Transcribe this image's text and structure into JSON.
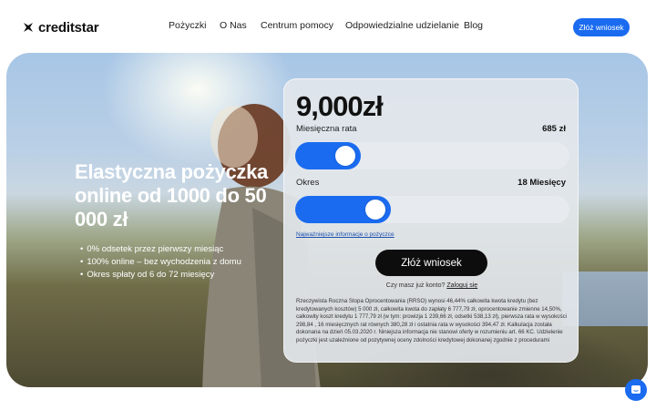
{
  "header": {
    "logo_text": "creditstar",
    "nav": [
      "Pożyczki",
      "O Nas",
      "Centrum pomocy",
      "Odpowiedzialne udzielanie",
      "Blog"
    ],
    "cta_label": "Złóż wniosek"
  },
  "hero": {
    "title": "Elastyczna pożyczka online od 1000 do 50 000 zł",
    "bullets": [
      "0% odsetek przez pierwszy miesiąc",
      "100% online – bez wychodzenia z domu",
      "Okres spłaty od 6 do 72 miesięcy"
    ]
  },
  "calculator": {
    "amount": "9,000zł",
    "monthly_label": "Miesięczna rata",
    "monthly_value": "685 zł",
    "amount_slider_fill": 0.24,
    "period_label": "Okres",
    "period_value": "18 Miesięcy",
    "period_slider_fill": 0.35,
    "info_link": "Najważniejsze informacje o pożyczce",
    "apply_label": "Złóż wniosek",
    "login_prompt": "Czy masz już konto?",
    "login_link": "Zaloguj się",
    "disclaimer": "Rzeczywista Roczna Stopa Oprocentowania (RRSO) wynosi 46,44% całkowita kwota kredytu (bez kredytowanych kosztów) 5 000 zł, całkowita kwota do zapłaty 6 777,79 zł, oprocentowanie zmienne 14,50%, całkowity koszt kredytu 1 777,79 zł (w tym: prowizja 1 239,66 zł, odsetki 538,13 zł), pierwsza rata w wysokości 298,84 , 16 miesięcznych rat równych 380,28 zł i ostatnia rata w wysokości 394,47 zł. Kalkulacja została dokonana na dzień 05.03.2020 r. Niniejsza informacja nie stanowi oferty w rozumieniu art. 66 KC. Udzielenie pożyczki jest uzależnione od pozytywnej oceny zdolności kredytowej dokonanej zgodnie z procedurami"
  },
  "colors": {
    "accent": "#1a6bf0",
    "button_dark": "#0d0d0d"
  },
  "icons": {
    "logo": "creditstar-logo-icon",
    "chat": "chat-icon"
  }
}
